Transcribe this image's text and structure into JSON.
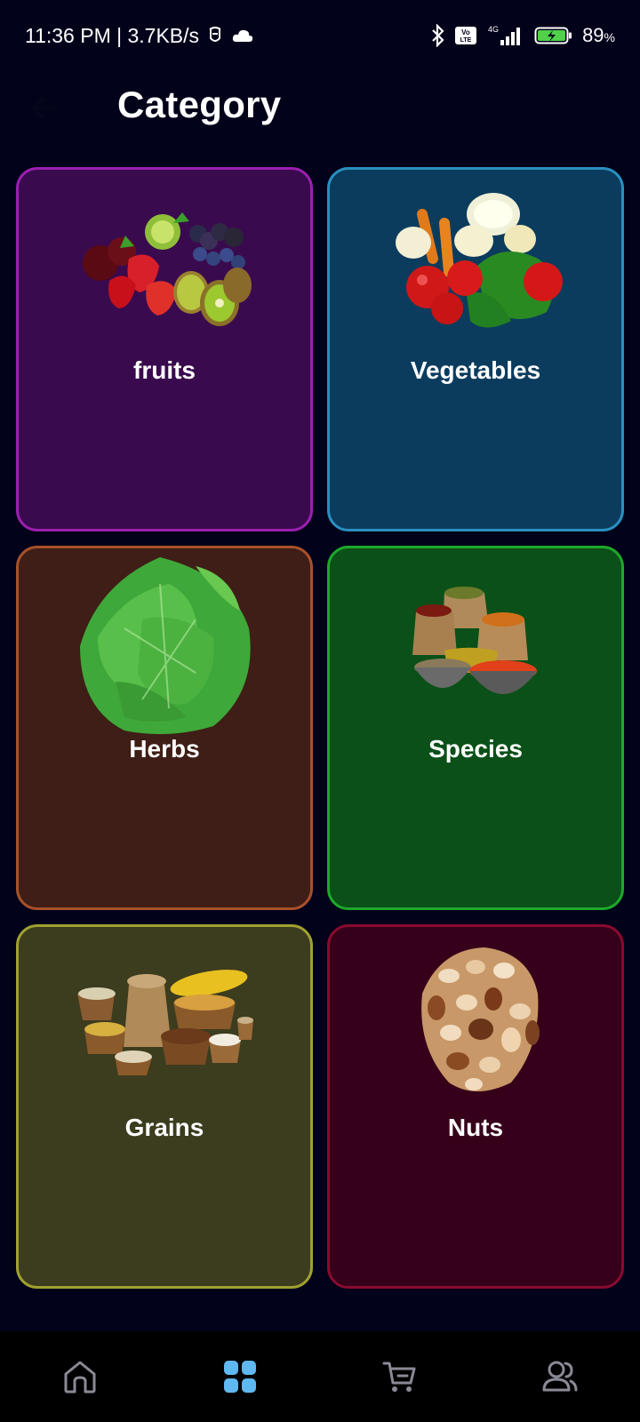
{
  "status_bar": {
    "time_speed": "11:36 PM | 3.7KB/s",
    "network": "4G",
    "volte": "Vo LTE",
    "battery_percent": "89",
    "battery_unit": "%"
  },
  "header": {
    "title": "Category"
  },
  "categories": [
    {
      "label": "fruits",
      "bg": "#3a0a4e",
      "border": "#9b1fb0"
    },
    {
      "label": "Vegetables",
      "bg": "#0b3c5e",
      "border": "#2a8fc0"
    },
    {
      "label": "Herbs",
      "bg": "#3e1e16",
      "border": "#a8502a"
    },
    {
      "label": "Species",
      "bg": "#0a5018",
      "border": "#1fa82a"
    },
    {
      "label": "Grains",
      "bg": "#3c3c1e",
      "border": "#a0a030"
    },
    {
      "label": "Nuts",
      "bg": "#36001a",
      "border": "#8a0a30"
    }
  ],
  "bottom_nav": {
    "items": [
      {
        "icon": "home-icon",
        "active": false
      },
      {
        "icon": "grid-icon",
        "active": true
      },
      {
        "icon": "cart-icon",
        "active": false
      },
      {
        "icon": "users-icon",
        "active": false
      }
    ],
    "active_color": "#5fb8f0",
    "inactive_color": "#8a8a96"
  }
}
